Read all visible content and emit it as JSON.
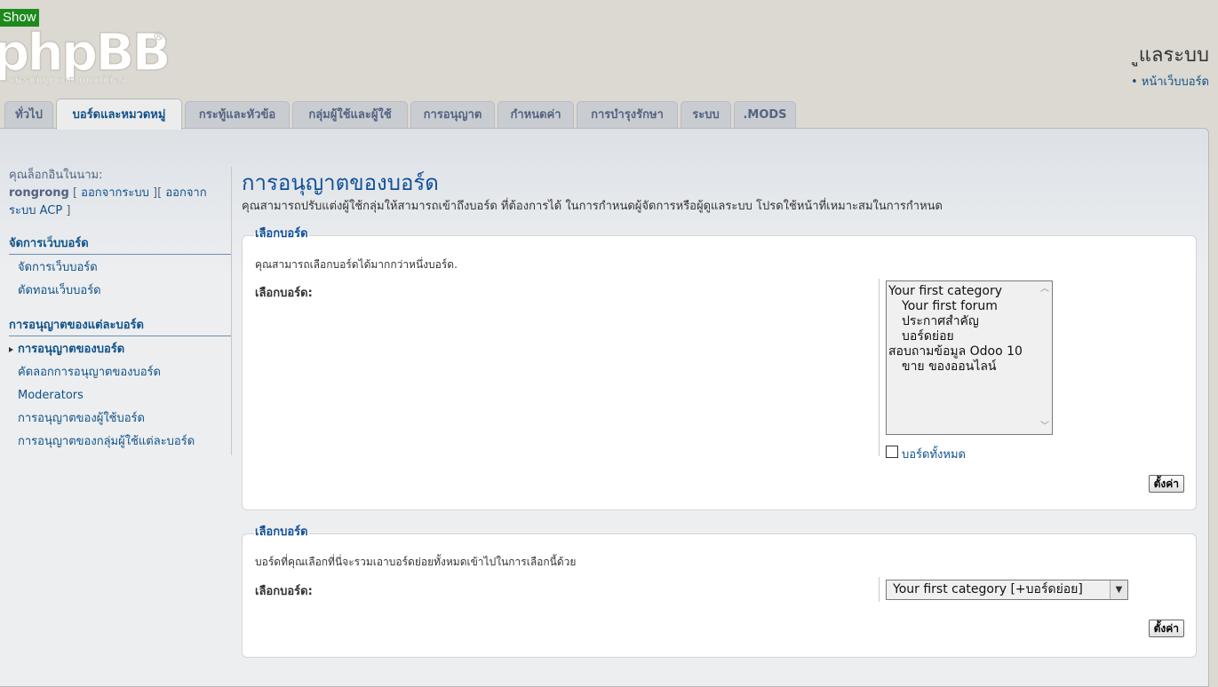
{
  "show_button": "Show",
  "logo": {
    "text": "phpBB",
    "tagline": "creating communities",
    "registered": "®"
  },
  "header": {
    "title": "ูแลระบบ",
    "link": "หน้าเว็บบอร์ด"
  },
  "tabs": [
    {
      "label": "ทั่วไป"
    },
    {
      "label": "บอร์ดและหมวดหมู่"
    },
    {
      "label": "กระทู้และหัวข้อ"
    },
    {
      "label": "กลุ่มผู้ใช้และผู้ใช้"
    },
    {
      "label": "การอนุญาต"
    },
    {
      "label": "กำหนดค่า"
    },
    {
      "label": "การบำรุงรักษา"
    },
    {
      "label": "ระบบ"
    },
    {
      "label": ".MODS"
    }
  ],
  "sidebar": {
    "logged_in_as": "คุณล็อกอินในนาม:",
    "username": "rongrong",
    "logout_link": "ออกจากระบบ",
    "logout_acp_link": "ออกจากระบบ ACP",
    "sections": [
      {
        "title": "จัดการเว็บบอร์ด",
        "items": [
          {
            "label": "จัดการเว็บบอร์ด"
          },
          {
            "label": "ตัดทอนเว็บบอร์ด"
          }
        ]
      },
      {
        "title": "การอนุญาตของแต่ละบอร์ด",
        "items": [
          {
            "label": "การอนุญาตของบอร์ด",
            "active": true
          },
          {
            "label": "คัดลอกการอนุญาตของบอร์ด"
          },
          {
            "label": "Moderators"
          },
          {
            "label": "การอนุญาตของผู้ใช้บอร์ด"
          },
          {
            "label": "การอนุญาตของกลุ่มผู้ใช้แต่ละบอร์ด"
          }
        ]
      }
    ]
  },
  "main": {
    "title": "การอนุญาตของบอร์ด",
    "description": "คุณสามารถปรับแต่งผู้ใช้กลุ่มให้สามารถเข้าถึงบอร์ด ที่ต้องการได้ ในการกำหนดผู้จัดการหรือผู้ดูแลระบบ โปรดใช้หน้าที่เหมาะสมในการกำหนด",
    "fieldset1": {
      "legend": "เลือกบอร์ด",
      "explain": "คุณสามารถเลือกบอร์ดได้มากกว่าหนึ่งบอร์ด.",
      "label": "เลือกบอร์ด:",
      "options": [
        {
          "text": "Your first category",
          "indent": false
        },
        {
          "text": "Your first forum",
          "indent": true
        },
        {
          "text": "ประกาศสำคัญ",
          "indent": true
        },
        {
          "text": "บอร์ดย่อย",
          "indent": true
        },
        {
          "text": "สอบถามข้อมูล Odoo 10",
          "indent": false
        },
        {
          "text": "ขาย ของออนไลน์",
          "indent": true
        }
      ],
      "all_forums_label": "บอร์ดทั้งหมด",
      "submit": "ตั้งค่า"
    },
    "fieldset2": {
      "legend": "เลือกบอร์ด",
      "explain": "บอร์ดที่คุณเลือกที่นี่จะรวมเอาบอร์ดย่อยทั้งหมดเข้าไปในการเลือกนี้ด้วย",
      "label": "เลือกบอร์ด:",
      "selected": "Your first category [+บอร์ดย่อย]",
      "submit": "ตั้งค่า"
    }
  }
}
